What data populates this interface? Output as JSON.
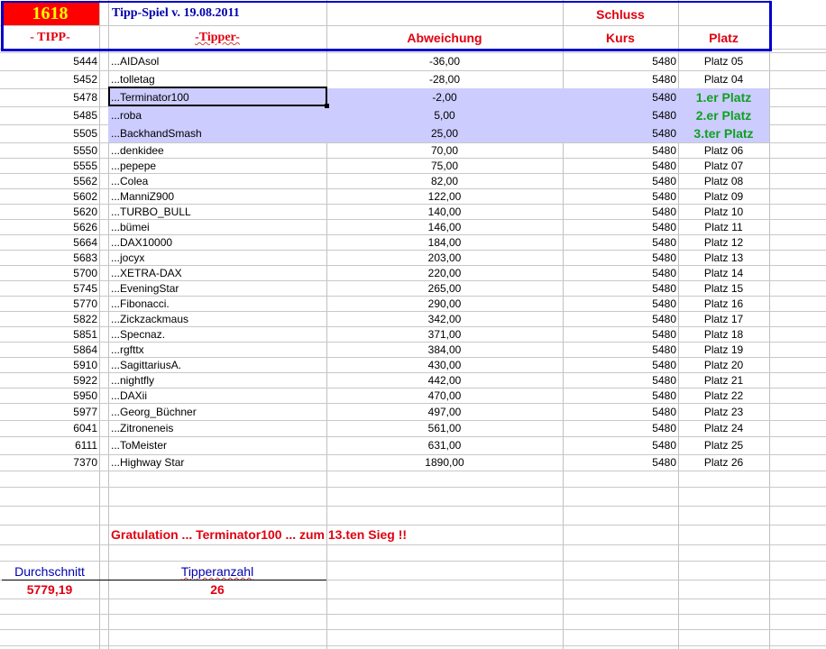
{
  "header": {
    "tipp_number": "1618",
    "title": "Tipp-Spiel v. 19.08.2011",
    "schluss": "Schluss",
    "col_tipp": "- TIPP-",
    "col_tipper": "-Tipper-",
    "col_abweichung": "Abweichung",
    "col_kurs": "Kurs",
    "col_platz": "Platz"
  },
  "colors": {
    "header_bg": "#ff0000",
    "tipp_number": "#ffff00",
    "highlight": "#ccccff",
    "border": "#0000cc",
    "accent_red": "#e00010",
    "winner_green": "#10a020"
  },
  "rows": [
    {
      "tipp": "5444",
      "tipper": "...AIDAsol",
      "abweichung": "-36,00",
      "kurs": "5480",
      "platz": "Platz 05"
    },
    {
      "tipp": "5452",
      "tipper": "...tolletag",
      "abweichung": "-28,00",
      "kurs": "5480",
      "platz": "Platz 04"
    },
    {
      "tipp": "5478",
      "tipper": "...Terminator100",
      "abweichung": "-2,00",
      "kurs": "5480",
      "platz": "1.er Platz"
    },
    {
      "tipp": "5485",
      "tipper": "...roba",
      "abweichung": "5,00",
      "kurs": "5480",
      "platz": "2.er Platz"
    },
    {
      "tipp": "5505",
      "tipper": "...BackhandSmash",
      "abweichung": "25,00",
      "kurs": "5480",
      "platz": "3.ter Platz"
    },
    {
      "tipp": "5550",
      "tipper": "...denkidee",
      "abweichung": "70,00",
      "kurs": "5480",
      "platz": "Platz 06"
    },
    {
      "tipp": "5555",
      "tipper": "...pepepe",
      "abweichung": "75,00",
      "kurs": "5480",
      "platz": "Platz 07"
    },
    {
      "tipp": "5562",
      "tipper": "...Colea",
      "abweichung": "82,00",
      "kurs": "5480",
      "platz": "Platz 08"
    },
    {
      "tipp": "5602",
      "tipper": "...ManniZ900",
      "abweichung": "122,00",
      "kurs": "5480",
      "platz": "Platz 09"
    },
    {
      "tipp": "5620",
      "tipper": "...TURBO_BULL",
      "abweichung": "140,00",
      "kurs": "5480",
      "platz": "Platz 10"
    },
    {
      "tipp": "5626",
      "tipper": "...bümei",
      "abweichung": "146,00",
      "kurs": "5480",
      "platz": "Platz 11"
    },
    {
      "tipp": "5664",
      "tipper": "...DAX10000",
      "abweichung": "184,00",
      "kurs": "5480",
      "platz": "Platz 12"
    },
    {
      "tipp": "5683",
      "tipper": "...jocyx",
      "abweichung": "203,00",
      "kurs": "5480",
      "platz": "Platz 13"
    },
    {
      "tipp": "5700",
      "tipper": "...XETRA-DAX",
      "abweichung": "220,00",
      "kurs": "5480",
      "platz": "Platz 14"
    },
    {
      "tipp": "5745",
      "tipper": "...EveningStar",
      "abweichung": "265,00",
      "kurs": "5480",
      "platz": "Platz 15"
    },
    {
      "tipp": "5770",
      "tipper": "...Fibonacci.",
      "abweichung": "290,00",
      "kurs": "5480",
      "platz": "Platz 16"
    },
    {
      "tipp": "5822",
      "tipper": "...Zickzackmaus",
      "abweichung": "342,00",
      "kurs": "5480",
      "platz": "Platz 17"
    },
    {
      "tipp": "5851",
      "tipper": "...Specnaz.",
      "abweichung": "371,00",
      "kurs": "5480",
      "platz": "Platz 18"
    },
    {
      "tipp": "5864",
      "tipper": "...rgfttx",
      "abweichung": "384,00",
      "kurs": "5480",
      "platz": "Platz 19"
    },
    {
      "tipp": "5910",
      "tipper": "...SagittariusA.",
      "abweichung": "430,00",
      "kurs": "5480",
      "platz": "Platz 20"
    },
    {
      "tipp": "5922",
      "tipper": "...nightfly",
      "abweichung": "442,00",
      "kurs": "5480",
      "platz": "Platz 21"
    },
    {
      "tipp": "5950",
      "tipper": "...DAXii",
      "abweichung": "470,00",
      "kurs": "5480",
      "platz": "Platz 22"
    },
    {
      "tipp": "5977",
      "tipper": "...Georg_Büchner",
      "abweichung": "497,00",
      "kurs": "5480",
      "platz": "Platz 23"
    },
    {
      "tipp": "6041",
      "tipper": "...Zitroneneis",
      "abweichung": "561,00",
      "kurs": "5480",
      "platz": "Platz 24"
    },
    {
      "tipp": "6111",
      "tipper": "...ToMeister",
      "abweichung": "631,00",
      "kurs": "5480",
      "platz": "Platz 25"
    },
    {
      "tipp": "7370",
      "tipper": "...Highway Star",
      "abweichung": "1890,00",
      "kurs": "5480",
      "platz": "Platz 26"
    }
  ],
  "footer": {
    "congrats": "Gratulation ... Terminator100  ...   zum   13.ten Sieg !!",
    "durchschnitt_label": "Durchschnitt",
    "durchschnitt_value": "5779,19",
    "tipperanzahl_label": "Tipperanzahl",
    "tipperanzahl_value": "26"
  }
}
